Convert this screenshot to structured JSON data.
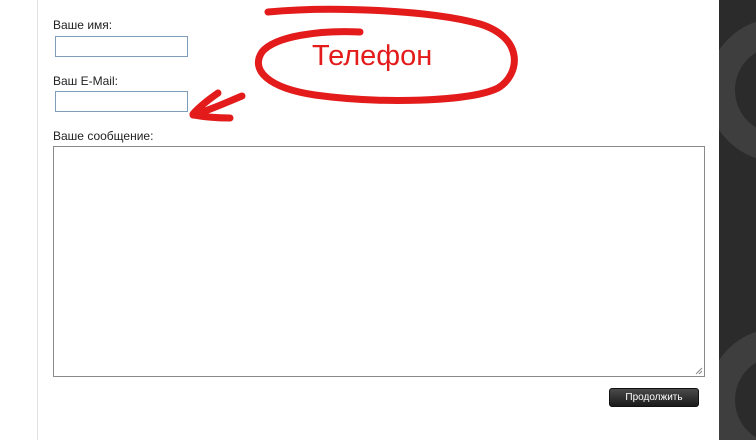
{
  "form": {
    "name_label": "Ваше имя:",
    "name_value": "",
    "email_label": "Ваш E-Mail:",
    "email_value": "",
    "message_label": "Ваше сообщение:",
    "message_value": "",
    "submit_label": "Продолжить"
  },
  "annotation": {
    "text": "Телефон",
    "color": "#e31b1b"
  },
  "theme": {
    "sidebar_color": "#2b2b2b",
    "button_color": "#1a1a1a"
  }
}
